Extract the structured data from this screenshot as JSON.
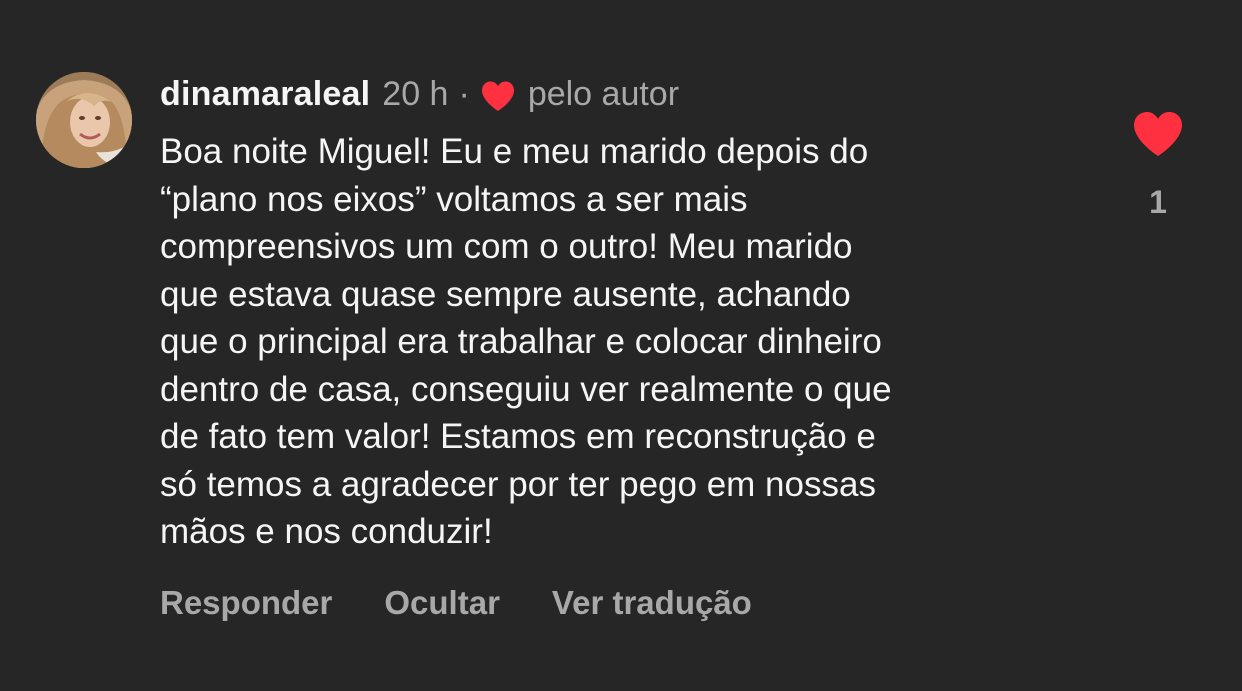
{
  "comment": {
    "username": "dinamaraleal",
    "time": "20 h",
    "separator": "·",
    "liked_by_author_label": "pelo autor",
    "text_lines": [
      "Boa noite Miguel! Eu e meu marido depois do",
      "“plano nos eixos” voltamos a ser mais",
      "compreensivos um com o outro! Meu marido",
      "que estava quase sempre ausente, achando",
      "que o principal era trabalhar e colocar dinheiro",
      "dentro de casa, conseguiu ver realmente o que",
      "de fato tem valor! Estamos em reconstrução e",
      "só temos a agradecer por ter pego em nossas",
      "mãos e nos conduzir!"
    ],
    "actions": {
      "reply": "Responder",
      "hide": "Ocultar",
      "translate": "Ver tradução"
    },
    "like_count": "1",
    "liked": true
  },
  "icons": {
    "author_heart": "heart-icon",
    "like_button": "heart-icon"
  },
  "colors": {
    "background": "#262626",
    "heart": "#ff3040",
    "primary_text": "#f5f5f5",
    "secondary_text": "#a8a8a8"
  }
}
